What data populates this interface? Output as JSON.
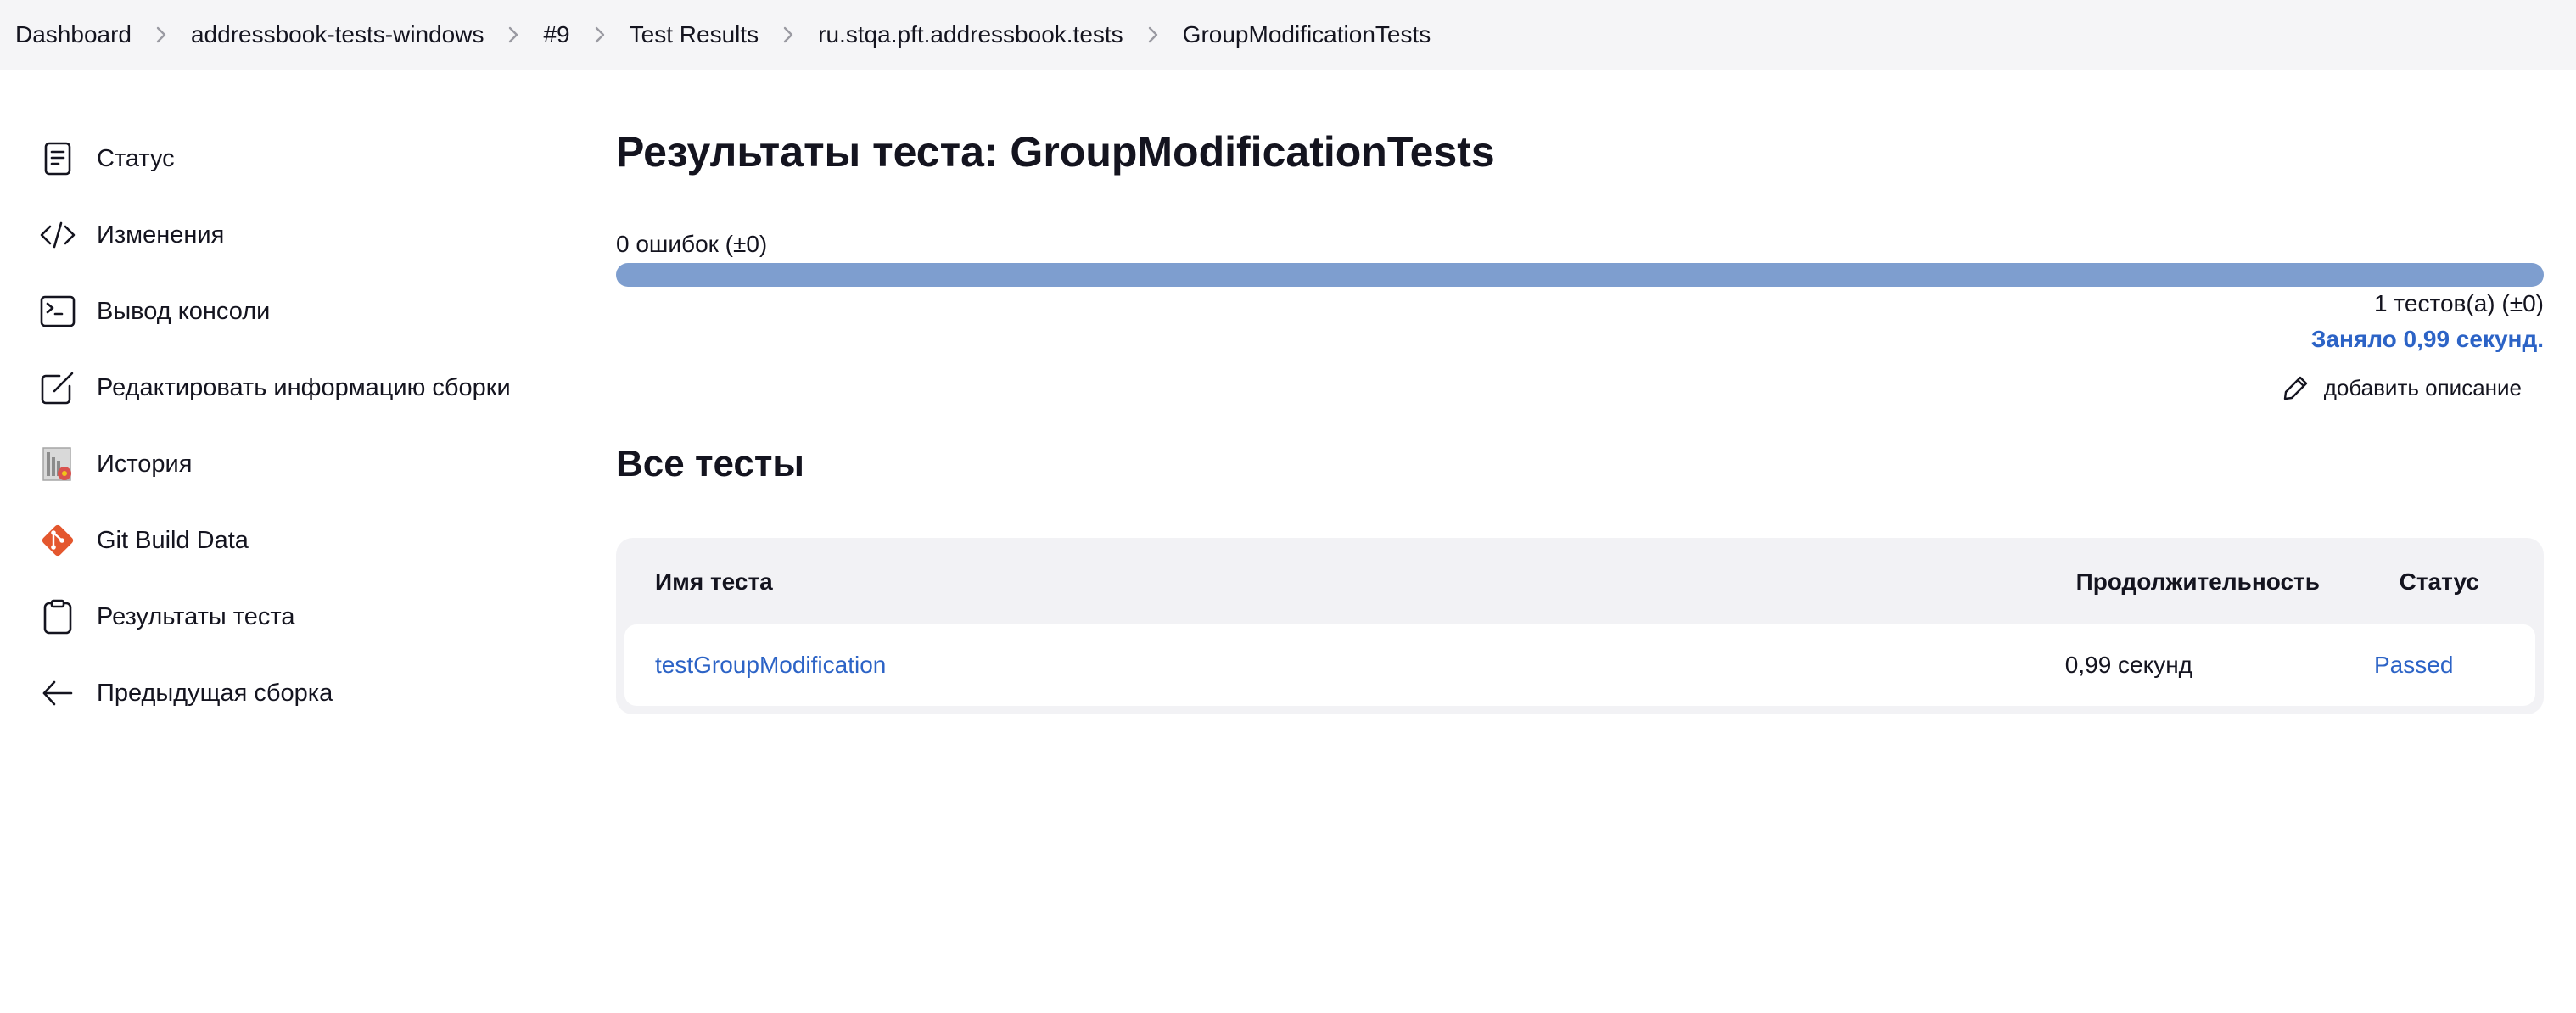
{
  "breadcrumb": {
    "items": [
      {
        "label": "Dashboard"
      },
      {
        "label": "addressbook-tests-windows"
      },
      {
        "label": "#9"
      },
      {
        "label": "Test Results"
      },
      {
        "label": "ru.stqa.pft.addressbook.tests"
      },
      {
        "label": "GroupModificationTests"
      }
    ]
  },
  "sidebar": {
    "items": [
      {
        "label": "Статус",
        "icon": "document-icon"
      },
      {
        "label": "Изменения",
        "icon": "code-icon"
      },
      {
        "label": "Вывод консоли",
        "icon": "terminal-icon"
      },
      {
        "label": "Редактировать информацию сборки",
        "icon": "edit-icon"
      },
      {
        "label": "История",
        "icon": "history-icon"
      },
      {
        "label": "Git Build Data",
        "icon": "git-icon"
      },
      {
        "label": "Результаты теста",
        "icon": "clipboard-icon"
      },
      {
        "label": "Предыдущая сборка",
        "icon": "arrow-left-icon"
      }
    ]
  },
  "main": {
    "title": "Результаты теста: GroupModificationTests",
    "fail_summary": "0 ошибок (±0)",
    "test_count": "1 тестов(а) (±0)",
    "duration_note": "Заняло 0,99 секунд.",
    "add_description": "добавить описание",
    "section_title": "Все тесты",
    "progress_fraction": 1.0
  },
  "table": {
    "headers": {
      "name": "Имя теста",
      "duration": "Продолжительность",
      "status": "Статус"
    },
    "rows": [
      {
        "name": "testGroupModification",
        "duration": "0,99 секунд",
        "status": "Passed"
      }
    ]
  },
  "colors": {
    "accent": "#2c63c6",
    "progress_bar": "#7e9ecf",
    "breadcrumb_bg": "#f5f5f7",
    "git_orange": "#e4572e"
  }
}
